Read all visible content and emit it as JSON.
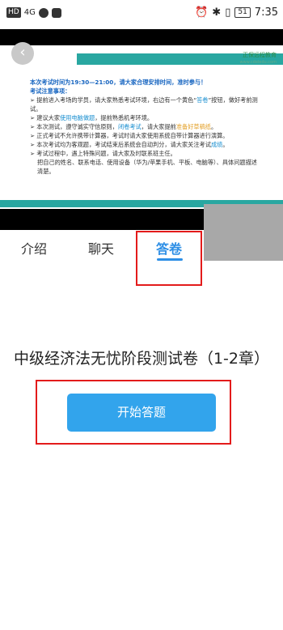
{
  "status_bar": {
    "hd": "HD",
    "network": "4G",
    "time": "7:35",
    "battery": "51"
  },
  "slide": {
    "logo_name": "正保远程教育",
    "logo_url": "www.cdeledu.com",
    "time_line": "本次考试时间为19:30—21:00，请大家合理安排时间，准时参与！",
    "notice_title": "考试注意事项：",
    "item1_a": "➢ 提前进入考场的学员，请大家熟悉考试环境，右边有一个黄色“",
    "item1_hl": "答卷",
    "item1_b": "”按钮，做好考前测试。",
    "item2_a": "➢ 建议大家",
    "item2_hl": "使用电脑做题",
    "item2_b": "，提前熟悉机考环境。",
    "item3_a": "➢ 本次测试，遵守诚实守信原则，",
    "item3_hl": "闭卷考试",
    "item3_b": "，请大家提前",
    "item3_hl2": "准备好草稿纸",
    "item3_c": "。",
    "item4": "➢ 正式考试不允许携带计算器，考试时请大家使用系统自带计算器进行演算。",
    "item5_a": "➢ 本次考试均为客观题，考试结束后系统会自动判分，请大家关注考试",
    "item5_hl": "成绩",
    "item5_b": "。",
    "item6": "➢ 考试过程中，遇上特殊问题，请大家及时联系班主任。",
    "item6_b": "把自己的姓名、联系电话、使用设备（华为/苹果手机、平板、电脑等）、具体问题描述清楚。"
  },
  "tabs": [
    {
      "label": "介绍"
    },
    {
      "label": "聊天"
    },
    {
      "label": "答卷"
    }
  ],
  "main": {
    "exam_title": "中级经济法无忧阶段测试卷（1-2章）",
    "start_button": "开始答题"
  },
  "colors": {
    "accent": "#2e8fe6",
    "button": "#32a4ec",
    "highlight_box": "#e31b1b",
    "slide_stripe": "#29a7a1"
  }
}
